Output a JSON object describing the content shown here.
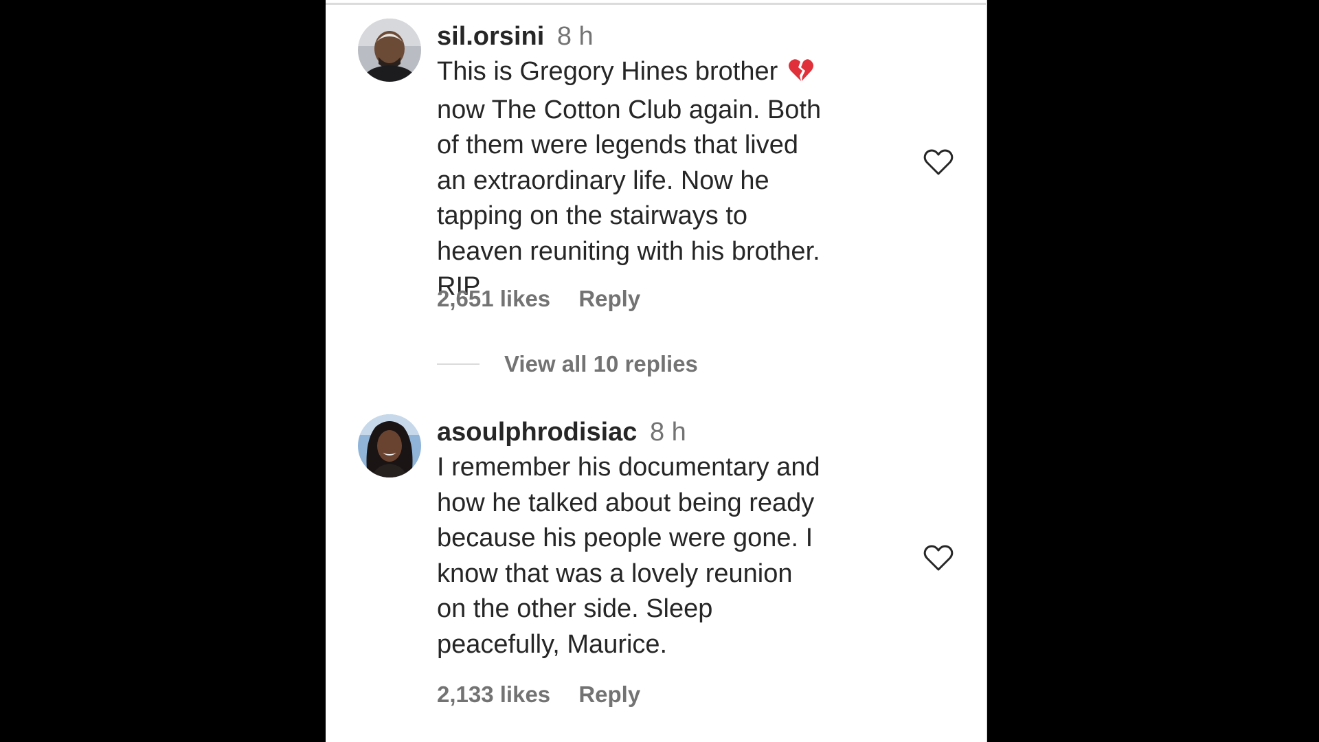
{
  "comments": [
    {
      "username": "sil.orsini",
      "time": "8 h",
      "text_part1": "This is Gregory Hines brother",
      "emoji": "broken-heart",
      "text_part2": "now The Cotton Club again. Both of them were legends that lived an extraordinary life. Now he tapping on the stairways to heaven reuniting with his brother. RIP",
      "likes": "2,651 likes",
      "reply_label": "Reply",
      "view_replies_label": "View all 10 replies"
    },
    {
      "username": "asoulphrodisiac",
      "time": "8 h",
      "text": "I remember his documentary and how he talked about being ready because his people were gone. I know that was a lovely reunion on the other side. Sleep peacefully, Maurice.",
      "likes": "2,133 likes",
      "reply_label": "Reply"
    }
  ],
  "icons": {
    "like": "heart-outline-icon",
    "broken_heart": "broken-heart-emoji"
  },
  "colors": {
    "text_primary": "#262626",
    "text_secondary": "#737373",
    "background": "#ffffff",
    "divider": "#dbdbdb",
    "outer_background": "#000000",
    "broken_heart": "#e0303a"
  }
}
